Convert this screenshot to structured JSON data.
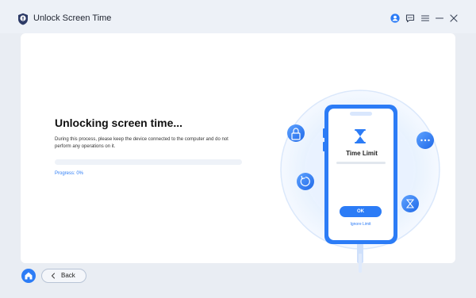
{
  "window": {
    "title": "Unlock Screen Time",
    "icons": [
      "user-icon",
      "feedback-icon",
      "menu-icon",
      "minimize-icon",
      "close-icon"
    ]
  },
  "main": {
    "heading": "Unlocking screen time...",
    "description": "During this process, please keep the device connected to the computer and do not perform any operations on it.",
    "progress_label": "Progress: 0%",
    "progress_value": 0
  },
  "illustration": {
    "phone_title": "Time Limit",
    "ok_label": "OK",
    "ignore_label": "Ignore Limit",
    "icons": [
      "hourglass-icon",
      "lock-icon",
      "more-icon",
      "refresh-icon",
      "hourglass-icon"
    ]
  },
  "footer": {
    "back_label": "Back",
    "icons": [
      "home-icon",
      "chevron-left-icon"
    ]
  },
  "colors": {
    "accent": "#2c7cf6",
    "background": "#e9edf3",
    "card": "#ffffff"
  }
}
